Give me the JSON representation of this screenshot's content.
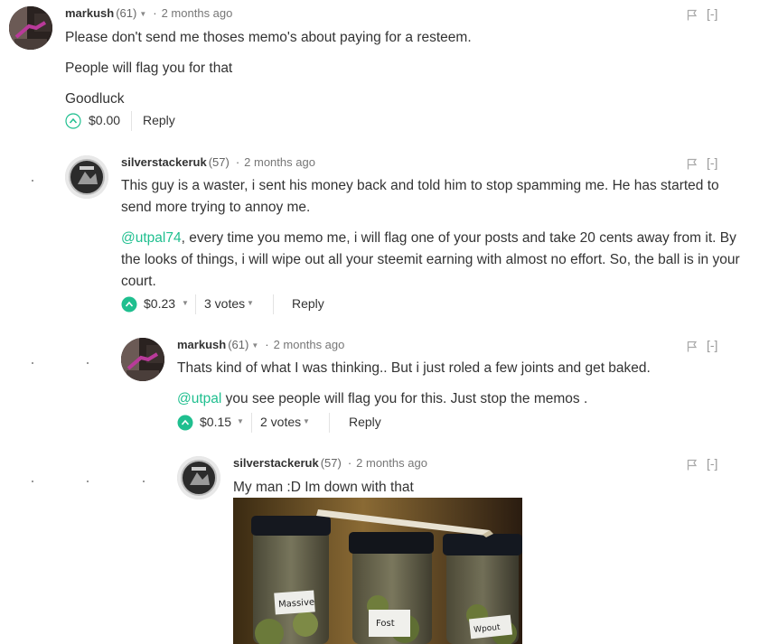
{
  "comments": [
    {
      "author": "markush",
      "reputation": "(61)",
      "separator": "·",
      "time": "2 months ago",
      "paragraphs": [
        "Please don't send me thoses memo's about paying for a resteem.",
        "People will flag you for that",
        "Goodluck"
      ],
      "payout": "$0.00",
      "reply_label": "Reply",
      "collapse_label": "[-]"
    },
    {
      "author": "silverstackeruk",
      "reputation": "(57)",
      "separator": "·",
      "time": "2 months ago",
      "paragraph1": "This guy is a waster, i sent his money back and told him to stop spamming me. He has started to send more trying to annoy me.",
      "mention": "@utpal74",
      "paragraph2_rest": ", every time you memo me, i will flag one of your posts and take 20 cents away from it. By the looks of things, i will wipe out all your steemit earning with almost no effort. So, the ball is in your court.",
      "payout": "$0.23",
      "votes": "3 votes",
      "reply_label": "Reply",
      "collapse_label": "[-]"
    },
    {
      "author": "markush",
      "reputation": "(61)",
      "separator": "·",
      "time": "2 months ago",
      "paragraph1": "Thats kind of what I was thinking.. But i just roled a few joints and get baked.",
      "mention": "@utpal",
      "paragraph2_rest": " you see people will flag you for this. Just stop the memos .",
      "payout": "$0.15",
      "votes": "2 votes",
      "reply_label": "Reply",
      "collapse_label": "[-]"
    },
    {
      "author": "silverstackeruk",
      "reputation": "(57)",
      "separator": "·",
      "time": "2 months ago",
      "paragraph1": "My man :D Im down with that",
      "collapse_label": "[-]",
      "jar_labels": [
        "Massive",
        "Fost",
        "Wpout"
      ]
    }
  ],
  "colors": {
    "accent": "#1fbf8f",
    "text": "#333333",
    "muted": "#777777"
  },
  "icons": {
    "upvote_active": "chevron-up-circle-filled",
    "upvote_inactive": "chevron-up-circle-outline",
    "flag": "flag-icon"
  }
}
